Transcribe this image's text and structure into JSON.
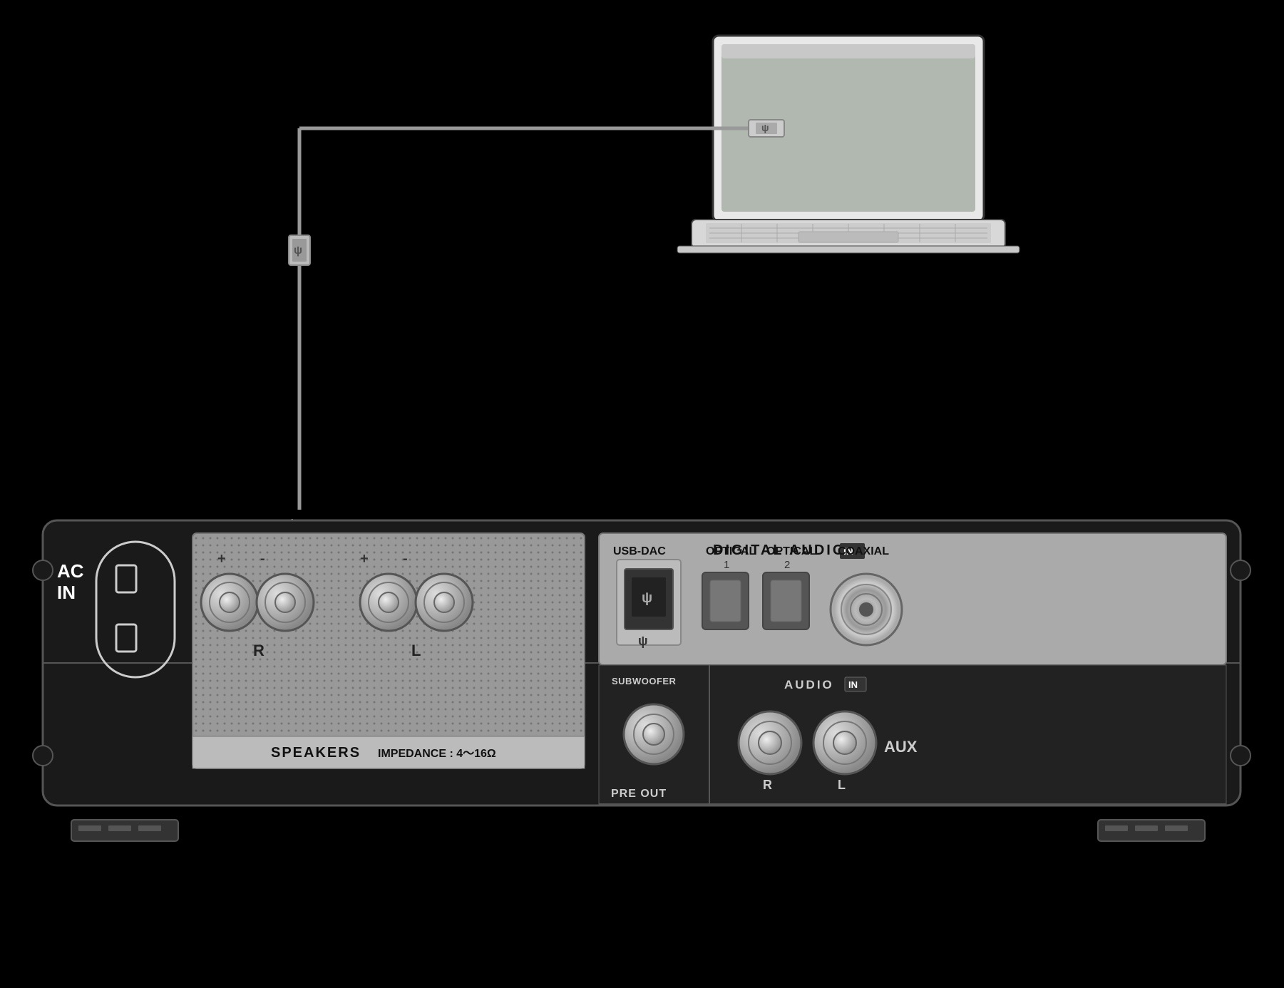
{
  "background_color": "#000000",
  "device": {
    "ac_in_label": "AC\nIN",
    "speakers_label": "SPEAKERS",
    "impedance_label": "IMPEDANCE : 4～16Ω",
    "r_label": "R",
    "l_label": "L",
    "digital_audio_title": "DIGITAL  AUDIO",
    "digital_in_badge": "IN",
    "usb_dac_label": "USB-DAC",
    "optical_1_label": "OPTICAL",
    "optical_1_sub": "1",
    "optical_2_label": "OPTICAL",
    "optical_2_sub": "2",
    "coaxial_label": "COAXIAL",
    "subwoofer_label": "SUBWOOFER",
    "pre_out_label": "PRE OUT",
    "audio_title": "AUDIO",
    "audio_in_badge": "IN",
    "aux_label": "AUX",
    "terminal_r_label": "R",
    "terminal_l_label": "L"
  },
  "cable": {
    "usb_symbol": "ψ"
  }
}
